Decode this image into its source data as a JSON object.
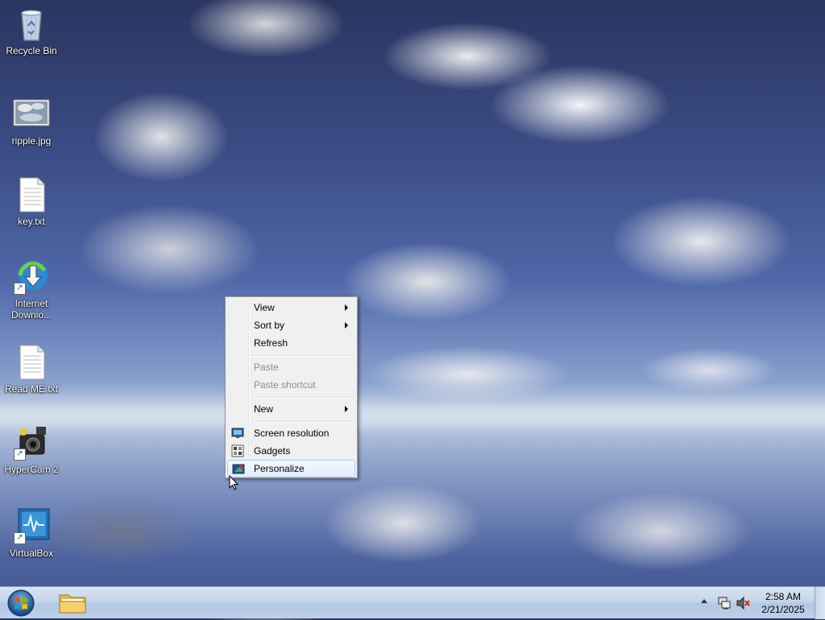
{
  "desktop": {
    "icons": [
      {
        "label": "Recycle Bin",
        "icon": "recycle-bin-icon"
      },
      {
        "label": "ripple.jpg",
        "icon": "image-file-icon"
      },
      {
        "label": "key.txt",
        "icon": "text-file-icon"
      },
      {
        "label": "Internet\nDownlo...",
        "icon": "internet-download-manager-icon"
      },
      {
        "label": "Read ME.txt",
        "icon": "text-file-icon"
      },
      {
        "label": "HyperCam 2",
        "icon": "hypercam-icon"
      },
      {
        "label": "VirtualBox",
        "icon": "virtualbox-icon"
      }
    ]
  },
  "context_menu": {
    "view": "View",
    "sort_by": "Sort by",
    "refresh": "Refresh",
    "paste": "Paste",
    "paste_shortcut": "Paste shortcut",
    "new": "New",
    "screen_resolution": "Screen resolution",
    "gadgets": "Gadgets",
    "personalize": "Personalize"
  },
  "taskbar": {
    "time": "2:58 AM",
    "date": "2/21/2025"
  },
  "colors": {
    "menu_highlight_border": "#aeccf0",
    "taskbar_top": "#d9e4f1",
    "sky_dark": "#2a3560"
  }
}
